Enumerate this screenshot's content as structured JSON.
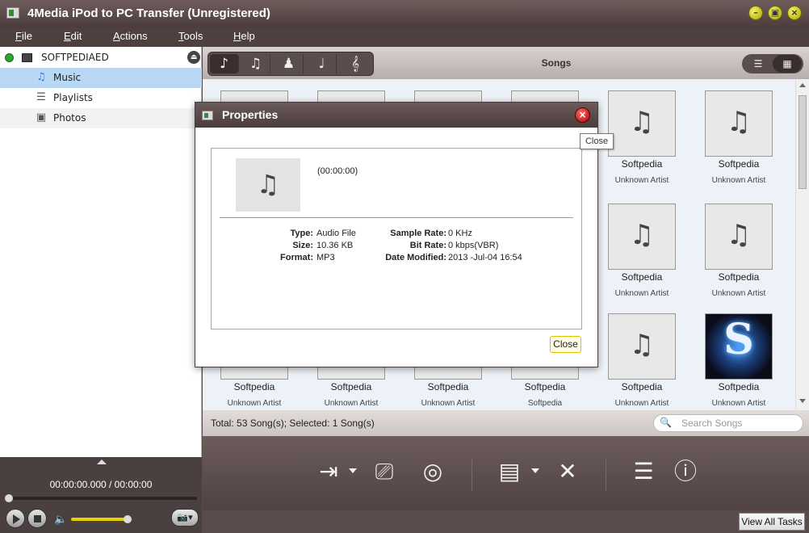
{
  "window": {
    "title": "4Media iPod to PC Transfer (Unregistered)"
  },
  "menu": [
    "File",
    "Edit",
    "Actions",
    "Tools",
    "Help"
  ],
  "sidebar": {
    "device": "SOFTPEDIAED",
    "items": [
      {
        "label": "Music",
        "icon": "music-note-icon",
        "selected": true
      },
      {
        "label": "Playlists",
        "icon": "playlist-icon",
        "selected": false
      },
      {
        "label": "Photos",
        "icon": "photo-icon",
        "selected": false
      }
    ]
  },
  "player": {
    "time": "00:00:00.000 / 00:00:00",
    "volume_level": 0.95
  },
  "content": {
    "title": "Songs",
    "categories": [
      "music-category-icon",
      "video-category-icon",
      "podcast-category-icon",
      "rock-category-icon",
      "classical-category-icon"
    ],
    "songs": [
      {
        "title": "Softpedia",
        "artist": "Unknown Artist"
      },
      {
        "title": "Softpedia",
        "artist": "Unknown Artist"
      },
      {
        "title": "Softpedia",
        "artist": "Unknown Artist"
      },
      {
        "title": "Softpedia",
        "artist": "Unknown Artist"
      },
      {
        "title": "Softpedia",
        "artist": "Unknown Artist"
      },
      {
        "title": "Softpedia",
        "artist": "Unknown Artist"
      },
      {
        "title": "Softpedia",
        "artist": "Unknown Artist"
      },
      {
        "title": "Softpedia",
        "artist": "Unknown Artist"
      },
      {
        "title": "Softpedia",
        "artist": "Unknown Artist"
      },
      {
        "title": "Softpedia",
        "artist": "Unknown Artist"
      },
      {
        "title": "Softpedia",
        "artist": "Unknown Artist"
      },
      {
        "title": "Softpedia",
        "artist": "Softpedia"
      },
      {
        "title": "Softpedia",
        "artist": "Unknown Artist"
      },
      {
        "title": "Softpedia",
        "artist": "Unknown Artist"
      }
    ]
  },
  "status": {
    "text": "Total: 53 Song(s); Selected: 1 Song(s)"
  },
  "search": {
    "placeholder": "Search Songs"
  },
  "actions": [
    "export-to-pc-icon",
    "export-to-device-icon",
    "add-to-itunes-icon",
    "add-file-icon",
    "delete-icon",
    "add-to-playlist-icon",
    "song-info-icon"
  ],
  "taskbar": {
    "view_all": "View All Tasks"
  },
  "dialog": {
    "title": "Properties",
    "duration": "(00:00:00)",
    "left": [
      {
        "k": "Type:",
        "v": "Audio File"
      },
      {
        "k": "Size:",
        "v": "10.36 KB"
      },
      {
        "k": "Format:",
        "v": "MP3"
      }
    ],
    "right": [
      {
        "k": "Sample Rate:",
        "v": "0 KHz"
      },
      {
        "k": "Bit Rate:",
        "v": "0 kbps(VBR)"
      },
      {
        "k": "Date Modified:",
        "v": "2013 -Jul-04 16:54"
      }
    ],
    "close_label": "Close",
    "tooltip": "Close"
  }
}
